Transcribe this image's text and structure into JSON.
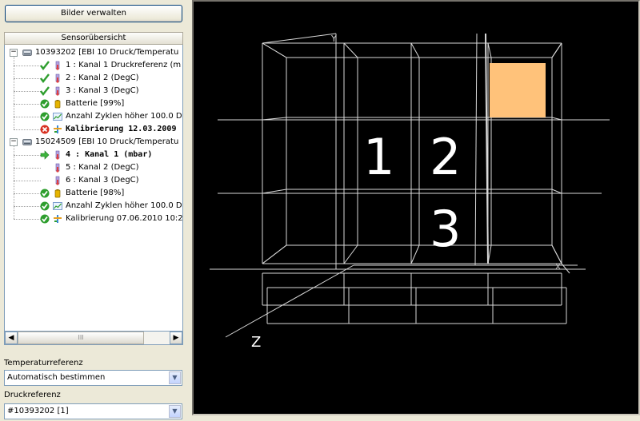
{
  "toolbar": {
    "manage_images_label": "Bilder verwalten"
  },
  "sensor_panel": {
    "title": "Sensorübersicht",
    "sensors": [
      {
        "label": "10393202 [EBI 10 Druck/Temperatu",
        "children": [
          {
            "label": "1 : Kanal 1 Druckreferenz (m",
            "status": "check",
            "icon": "thermometer-icon",
            "bold": false
          },
          {
            "label": "2 : Kanal 2  (DegC)",
            "status": "check",
            "icon": "thermometer-icon",
            "bold": false
          },
          {
            "label": "3 : Kanal 3  (DegC)",
            "status": "check",
            "icon": "thermometer-icon",
            "bold": false
          },
          {
            "label": "Batterie [99%]",
            "status": "ok",
            "icon": "battery-icon",
            "bold": false
          },
          {
            "label": "Anzahl Zyklen höher 100.0 D",
            "status": "ok",
            "icon": "chart-icon",
            "bold": false
          },
          {
            "label": "Kalibrierung 12.03.2009",
            "status": "error",
            "icon": "calibration-icon",
            "bold": true
          }
        ]
      },
      {
        "label": "15024509 [EBI 10 Druck/Temperatu",
        "children": [
          {
            "label": "4 : Kanal 1  (mbar)",
            "status": "arrow",
            "icon": "thermometer-icon",
            "bold": true
          },
          {
            "label": "5 : Kanal 2  (DegC)",
            "status": "none",
            "icon": "thermometer-icon",
            "bold": false
          },
          {
            "label": "6 : Kanal 3  (DegC)",
            "status": "none",
            "icon": "thermometer-icon",
            "bold": false
          },
          {
            "label": "Batterie [98%]",
            "status": "ok",
            "icon": "battery-icon",
            "bold": false
          },
          {
            "label": "Anzahl Zyklen höher 100.0 D",
            "status": "ok",
            "icon": "chart-icon",
            "bold": false
          },
          {
            "label": "Kalibrierung 07.06.2010 10:2",
            "status": "ok",
            "icon": "calibration-icon",
            "bold": false
          }
        ]
      }
    ]
  },
  "scrollbar": {
    "thumb_grip": "III"
  },
  "temperature_reference": {
    "label": "Temperaturreferenz",
    "value": "Automatisch bestimmen"
  },
  "pressure_reference": {
    "label": "Druckreferenz",
    "value": "#10393202 [1]"
  },
  "view3d": {
    "axis_y": "Y",
    "axis_z": "Z",
    "axis_x": "X",
    "markers": [
      "1",
      "2",
      "3"
    ],
    "highlight_color": "#ffc27a"
  },
  "colors": {
    "status_ok": "#2e9e2e",
    "status_error": "#d83020",
    "arrow": "#3cb43c"
  }
}
